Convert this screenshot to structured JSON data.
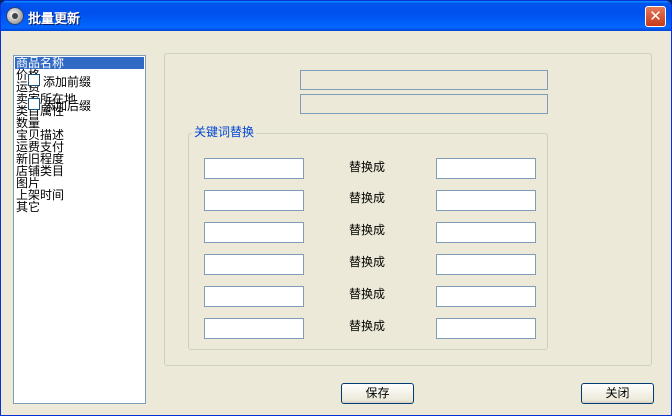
{
  "window": {
    "title": "批量更新",
    "close_glyph": "✕",
    "app_icon": "app-disc-icon"
  },
  "field_list": {
    "items": [
      "商品名称",
      "价格",
      "运费",
      "卖家所在地",
      "类目属性",
      "数量",
      "宝贝描述",
      "运费支付",
      "新旧程度",
      "店铺类目",
      "图片",
      "上架时间",
      "其它"
    ],
    "selected_index": 0
  },
  "options": {
    "add_prefix": {
      "label": "添加前缀",
      "checked": false,
      "value": ""
    },
    "add_suffix": {
      "label": "添加后缀",
      "checked": false,
      "value": ""
    }
  },
  "keyword_replace": {
    "title": "关键词替换",
    "replace_label": "替换成",
    "rows": [
      {
        "find": "",
        "replace": "",
        "label": "替换成"
      },
      {
        "find": "",
        "replace": "",
        "label": "替换成"
      },
      {
        "find": "",
        "replace": "",
        "label": "替换成"
      },
      {
        "find": "",
        "replace": "",
        "label": "替换成"
      },
      {
        "find": "",
        "replace": "",
        "label": "替换成"
      },
      {
        "find": "",
        "replace": "",
        "label": "替换成"
      }
    ]
  },
  "buttons": {
    "save": "保存",
    "close": "关闭"
  },
  "colors": {
    "title_bar": "#0053ee",
    "selection": "#316ac5",
    "group_title": "#0046d5",
    "window_bg": "#ece9d8"
  }
}
